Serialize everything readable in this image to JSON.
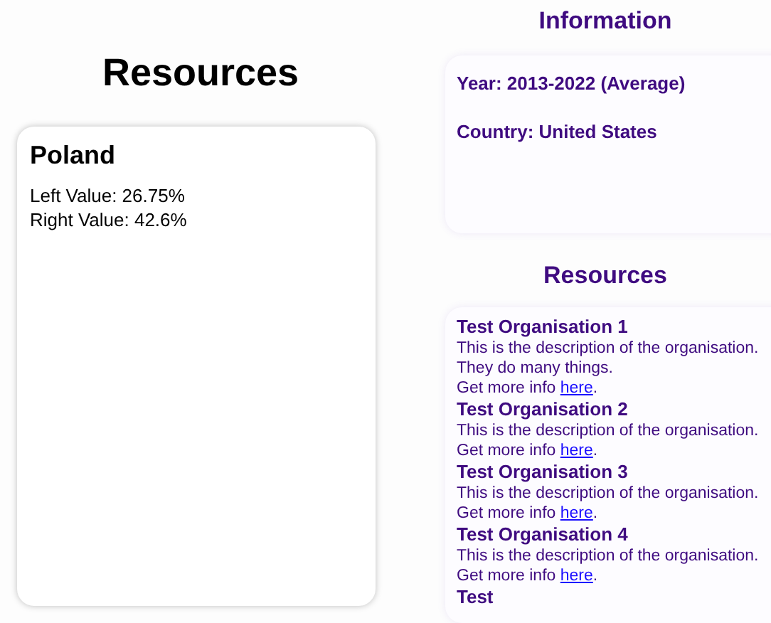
{
  "left": {
    "heading": "Resources",
    "card": {
      "title": "Poland",
      "lines": [
        "Left Value: 26.75%",
        "Right Value: 42.6%"
      ]
    }
  },
  "information": {
    "heading": "Information",
    "lines": [
      "Year: 2013-2022 (Average)",
      "Country: United States"
    ]
  },
  "resources": {
    "heading": "Resources",
    "organisations": [
      {
        "name": "Test Organisation 1",
        "description": "This is the description of the organisation. They do many things.",
        "more_prefix": "Get more info ",
        "link": "here",
        "more_suffix": "."
      },
      {
        "name": "Test Organisation 2",
        "description": "This is the description of the organisation.",
        "more_prefix": "Get more info ",
        "link": "here",
        "more_suffix": "."
      },
      {
        "name": "Test Organisation 3",
        "description": "This is the description of the organisation.",
        "more_prefix": "Get more info ",
        "link": "here",
        "more_suffix": "."
      },
      {
        "name": "Test Organisation 4",
        "description": "This is the description of the organisation.",
        "more_prefix": "Get more info ",
        "link": "here",
        "more_suffix": "."
      },
      {
        "name": "Test"
      }
    ]
  }
}
